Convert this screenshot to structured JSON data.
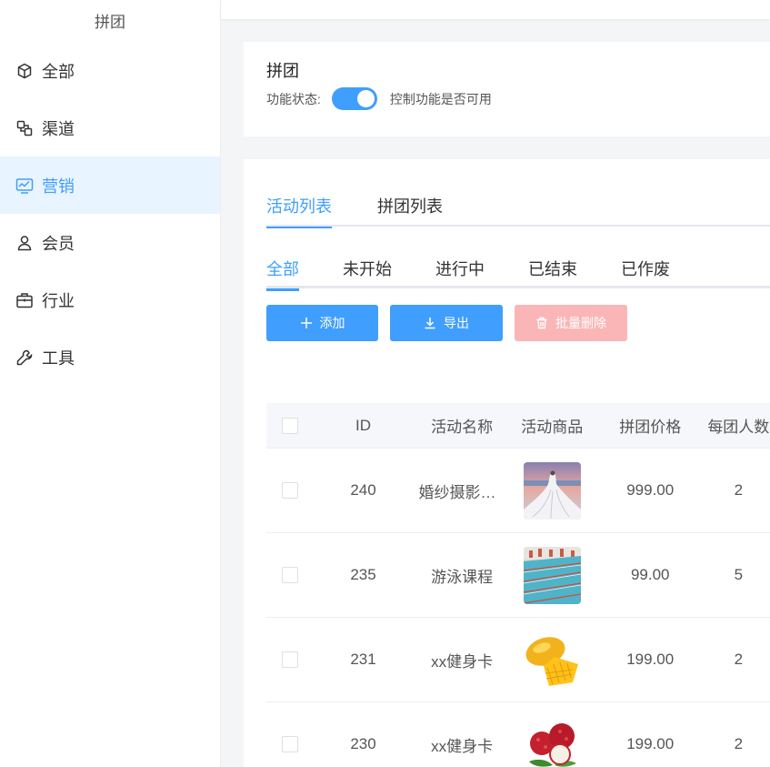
{
  "sidebar": {
    "title": "拼团",
    "items": [
      {
        "label": "全部",
        "icon": "cube-icon",
        "active": false
      },
      {
        "label": "渠道",
        "icon": "channel-icon",
        "active": false
      },
      {
        "label": "营销",
        "icon": "chart-monitor-icon",
        "active": true
      },
      {
        "label": "会员",
        "icon": "user-icon",
        "active": false
      },
      {
        "label": "行业",
        "icon": "briefcase-icon",
        "active": false
      },
      {
        "label": "工具",
        "icon": "wrench-icon",
        "active": false
      }
    ]
  },
  "function_card": {
    "title": "拼团",
    "status_label": "功能状态:",
    "switch_on": true,
    "switch_desc": "控制功能是否可用"
  },
  "main_tabs": [
    {
      "label": "活动列表",
      "active": true
    },
    {
      "label": "拼团列表",
      "active": false
    }
  ],
  "status_tabs": [
    {
      "label": "全部",
      "active": true
    },
    {
      "label": "未开始",
      "active": false
    },
    {
      "label": "进行中",
      "active": false
    },
    {
      "label": "已结束",
      "active": false
    },
    {
      "label": "已作废",
      "active": false
    }
  ],
  "buttons": {
    "add": "添加",
    "export": "导出",
    "batch_delete": "批量删除"
  },
  "colors": {
    "primary": "#409eff",
    "danger_disabled": "#fab6b6",
    "active_bg": "#e8f4ff"
  },
  "table": {
    "headers": {
      "id": "ID",
      "name": "活动名称",
      "goods": "活动商品",
      "price": "拼团价格",
      "count": "每团人数"
    },
    "rows": [
      {
        "id": "240",
        "name": "婚纱摄影套餐",
        "goods_image": "wedding-dress-photo",
        "price": "999.00",
        "count": "2"
      },
      {
        "id": "235",
        "name": "游泳课程",
        "goods_image": "swimming-pool-photo",
        "price": "99.00",
        "count": "5"
      },
      {
        "id": "231",
        "name": "xx健身卡",
        "goods_image": "mango-photo",
        "price": "199.00",
        "count": "2"
      },
      {
        "id": "230",
        "name": "xx健身卡",
        "goods_image": "lychee-photo",
        "price": "199.00",
        "count": "2"
      }
    ]
  }
}
